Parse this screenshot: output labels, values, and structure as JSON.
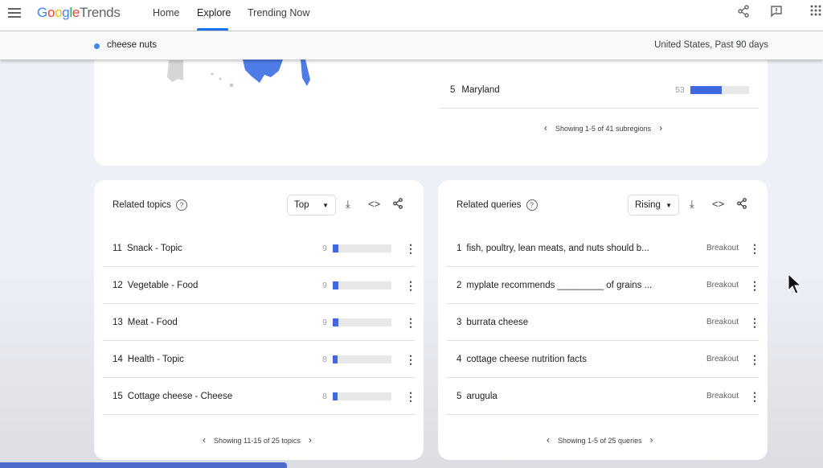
{
  "header": {
    "logo": "Google Trends",
    "nav": [
      "Home",
      "Explore",
      "Trending Now"
    ],
    "active": "Explore"
  },
  "subheader": {
    "term": "cheese nuts",
    "term_color": "#4285f4",
    "region": "United States, Past 90 days"
  },
  "subregions": {
    "row": {
      "rank": "5",
      "name": "Maryland",
      "value": 53
    },
    "pager": "Showing 1-5 of 41 subregions"
  },
  "related_topics": {
    "title": "Related topics",
    "filter": "Top",
    "rows": [
      {
        "rank": "11",
        "label": "Snack - Topic",
        "value": 9
      },
      {
        "rank": "12",
        "label": "Vegetable - Food",
        "value": 9
      },
      {
        "rank": "13",
        "label": "Meat - Food",
        "value": 9
      },
      {
        "rank": "14",
        "label": "Health - Topic",
        "value": 8
      },
      {
        "rank": "15",
        "label": "Cottage cheese - Cheese",
        "value": 8
      }
    ],
    "pager": "Showing 11-15 of 25 topics"
  },
  "related_queries": {
    "title": "Related queries",
    "filter": "Rising",
    "rows": [
      {
        "rank": "1",
        "label": "fish, poultry, lean meats, and nuts should b...",
        "value": "Breakout"
      },
      {
        "rank": "2",
        "label": "myplate recommends _________ of grains ...",
        "value": "Breakout"
      },
      {
        "rank": "3",
        "label": "burrata cheese",
        "value": "Breakout"
      },
      {
        "rank": "4",
        "label": "cottage cheese nutrition facts",
        "value": "Breakout"
      },
      {
        "rank": "5",
        "label": "arugula",
        "value": "Breakout"
      }
    ],
    "pager": "Showing 1-5 of 25 queries"
  },
  "colors": {
    "accent": "#1a73e8",
    "bar": "#4069e0"
  }
}
